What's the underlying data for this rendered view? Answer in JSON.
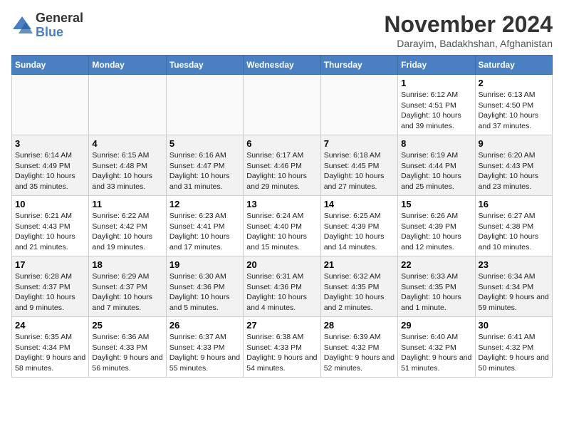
{
  "logo": {
    "general": "General",
    "blue": "Blue"
  },
  "title": "November 2024",
  "location": "Darayim, Badakhshan, Afghanistan",
  "weekdays": [
    "Sunday",
    "Monday",
    "Tuesday",
    "Wednesday",
    "Thursday",
    "Friday",
    "Saturday"
  ],
  "weeks": [
    [
      {
        "day": "",
        "info": ""
      },
      {
        "day": "",
        "info": ""
      },
      {
        "day": "",
        "info": ""
      },
      {
        "day": "",
        "info": ""
      },
      {
        "day": "",
        "info": ""
      },
      {
        "day": "1",
        "info": "Sunrise: 6:12 AM\nSunset: 4:51 PM\nDaylight: 10 hours\nand 39 minutes."
      },
      {
        "day": "2",
        "info": "Sunrise: 6:13 AM\nSunset: 4:50 PM\nDaylight: 10 hours\nand 37 minutes."
      }
    ],
    [
      {
        "day": "3",
        "info": "Sunrise: 6:14 AM\nSunset: 4:49 PM\nDaylight: 10 hours\nand 35 minutes."
      },
      {
        "day": "4",
        "info": "Sunrise: 6:15 AM\nSunset: 4:48 PM\nDaylight: 10 hours\nand 33 minutes."
      },
      {
        "day": "5",
        "info": "Sunrise: 6:16 AM\nSunset: 4:47 PM\nDaylight: 10 hours\nand 31 minutes."
      },
      {
        "day": "6",
        "info": "Sunrise: 6:17 AM\nSunset: 4:46 PM\nDaylight: 10 hours\nand 29 minutes."
      },
      {
        "day": "7",
        "info": "Sunrise: 6:18 AM\nSunset: 4:45 PM\nDaylight: 10 hours\nand 27 minutes."
      },
      {
        "day": "8",
        "info": "Sunrise: 6:19 AM\nSunset: 4:44 PM\nDaylight: 10 hours\nand 25 minutes."
      },
      {
        "day": "9",
        "info": "Sunrise: 6:20 AM\nSunset: 4:43 PM\nDaylight: 10 hours\nand 23 minutes."
      }
    ],
    [
      {
        "day": "10",
        "info": "Sunrise: 6:21 AM\nSunset: 4:43 PM\nDaylight: 10 hours\nand 21 minutes."
      },
      {
        "day": "11",
        "info": "Sunrise: 6:22 AM\nSunset: 4:42 PM\nDaylight: 10 hours\nand 19 minutes."
      },
      {
        "day": "12",
        "info": "Sunrise: 6:23 AM\nSunset: 4:41 PM\nDaylight: 10 hours\nand 17 minutes."
      },
      {
        "day": "13",
        "info": "Sunrise: 6:24 AM\nSunset: 4:40 PM\nDaylight: 10 hours\nand 15 minutes."
      },
      {
        "day": "14",
        "info": "Sunrise: 6:25 AM\nSunset: 4:39 PM\nDaylight: 10 hours\nand 14 minutes."
      },
      {
        "day": "15",
        "info": "Sunrise: 6:26 AM\nSunset: 4:39 PM\nDaylight: 10 hours\nand 12 minutes."
      },
      {
        "day": "16",
        "info": "Sunrise: 6:27 AM\nSunset: 4:38 PM\nDaylight: 10 hours\nand 10 minutes."
      }
    ],
    [
      {
        "day": "17",
        "info": "Sunrise: 6:28 AM\nSunset: 4:37 PM\nDaylight: 10 hours\nand 9 minutes."
      },
      {
        "day": "18",
        "info": "Sunrise: 6:29 AM\nSunset: 4:37 PM\nDaylight: 10 hours\nand 7 minutes."
      },
      {
        "day": "19",
        "info": "Sunrise: 6:30 AM\nSunset: 4:36 PM\nDaylight: 10 hours\nand 5 minutes."
      },
      {
        "day": "20",
        "info": "Sunrise: 6:31 AM\nSunset: 4:36 PM\nDaylight: 10 hours\nand 4 minutes."
      },
      {
        "day": "21",
        "info": "Sunrise: 6:32 AM\nSunset: 4:35 PM\nDaylight: 10 hours\nand 2 minutes."
      },
      {
        "day": "22",
        "info": "Sunrise: 6:33 AM\nSunset: 4:35 PM\nDaylight: 10 hours\nand 1 minute."
      },
      {
        "day": "23",
        "info": "Sunrise: 6:34 AM\nSunset: 4:34 PM\nDaylight: 9 hours\nand 59 minutes."
      }
    ],
    [
      {
        "day": "24",
        "info": "Sunrise: 6:35 AM\nSunset: 4:34 PM\nDaylight: 9 hours\nand 58 minutes."
      },
      {
        "day": "25",
        "info": "Sunrise: 6:36 AM\nSunset: 4:33 PM\nDaylight: 9 hours\nand 56 minutes."
      },
      {
        "day": "26",
        "info": "Sunrise: 6:37 AM\nSunset: 4:33 PM\nDaylight: 9 hours\nand 55 minutes."
      },
      {
        "day": "27",
        "info": "Sunrise: 6:38 AM\nSunset: 4:33 PM\nDaylight: 9 hours\nand 54 minutes."
      },
      {
        "day": "28",
        "info": "Sunrise: 6:39 AM\nSunset: 4:32 PM\nDaylight: 9 hours\nand 52 minutes."
      },
      {
        "day": "29",
        "info": "Sunrise: 6:40 AM\nSunset: 4:32 PM\nDaylight: 9 hours\nand 51 minutes."
      },
      {
        "day": "30",
        "info": "Sunrise: 6:41 AM\nSunset: 4:32 PM\nDaylight: 9 hours\nand 50 minutes."
      }
    ]
  ]
}
